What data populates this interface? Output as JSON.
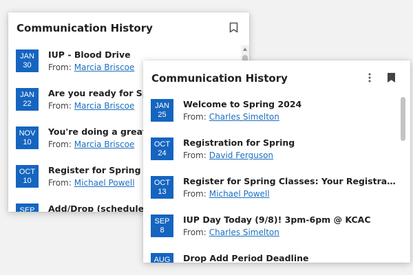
{
  "colors": {
    "accent": "#1565c0",
    "link": "#1a6fc0",
    "background": "#f2f2f2"
  },
  "back_card": {
    "title": "Communication History",
    "items": [
      {
        "month": "JAN",
        "day": "30",
        "subject": "IUP - Blood Drive",
        "from_label": "From:",
        "from": "Marcia Briscoe"
      },
      {
        "month": "JAN",
        "day": "22",
        "subject": "Are you ready for Spring",
        "from_label": "From:",
        "from": "Marcia Briscoe"
      },
      {
        "month": "NOV",
        "day": "10",
        "subject": "You're doing a great jo",
        "from_label": "From:",
        "from": "Marcia Briscoe"
      },
      {
        "month": "OCT",
        "day": "10",
        "subject": "Register for Spring Clas",
        "from_label": "From:",
        "from": "Michael Powell"
      },
      {
        "month": "SEP",
        "day": "",
        "subject": "Add/Drop (schedule ad",
        "from_label": "",
        "from": ""
      }
    ]
  },
  "front_card": {
    "title": "Communication History",
    "items": [
      {
        "month": "JAN",
        "day": "25",
        "subject": "Welcome to Spring 2024",
        "from_label": "From:",
        "from": "Charles Simelton"
      },
      {
        "month": "OCT",
        "day": "24",
        "subject": "Registration for Spring",
        "from_label": "From:",
        "from": "David Ferguson"
      },
      {
        "month": "OCT",
        "day": "13",
        "subject": "Register for Spring Classes: Your Registration ...",
        "from_label": "From:",
        "from": "Michael Powell"
      },
      {
        "month": "SEP",
        "day": "8",
        "subject": "IUP Day Today (9/8)! 3pm-6pm @ KCAC",
        "from_label": "From:",
        "from": "Charles Simelton"
      },
      {
        "month": "AUG",
        "day": "",
        "subject": "Drop Add Period Deadline",
        "from_label": "",
        "from": ""
      }
    ]
  },
  "icons": {
    "bookmark_outline": "bookmark-outline-icon",
    "bookmark_filled": "bookmark-filled-icon",
    "more": "more-vertical-icon"
  }
}
